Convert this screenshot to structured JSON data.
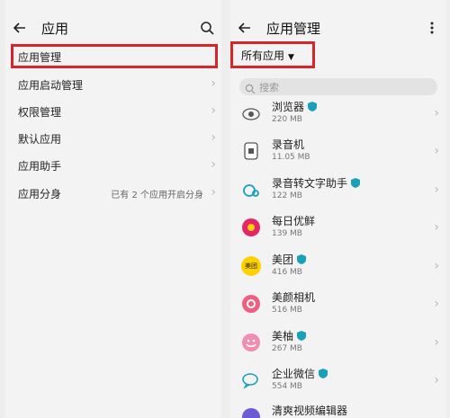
{
  "left": {
    "title": "应用",
    "items": [
      {
        "label": "应用管理"
      },
      {
        "label": "应用启动管理"
      },
      {
        "label": "权限管理"
      },
      {
        "label": "默认应用"
      },
      {
        "label": "应用助手"
      },
      {
        "label": "应用分身",
        "extra": "已有 2 个应用开启分身"
      }
    ]
  },
  "right": {
    "title": "应用管理",
    "filter_label": "所有应用",
    "search_placeholder": "搜索",
    "apps": [
      {
        "name": "浏览器",
        "size": "220 MB",
        "verified": true,
        "icon": "browser-icon"
      },
      {
        "name": "录音机",
        "size": "11.05 MB",
        "verified": false,
        "icon": "recorder-icon"
      },
      {
        "name": "录音转文字助手",
        "size": "122 MB",
        "verified": true,
        "icon": "transcribe-icon"
      },
      {
        "name": "每日优鲜",
        "size": "139 MB",
        "verified": false,
        "icon": "missfresh-icon"
      },
      {
        "name": "美团",
        "size": "416 MB",
        "verified": true,
        "icon": "meituan-icon",
        "icon_text": "美团"
      },
      {
        "name": "美颜相机",
        "size": "516 MB",
        "verified": false,
        "icon": "beauty-camera-icon"
      },
      {
        "name": "美柚",
        "size": "267 MB",
        "verified": true,
        "icon": "meiyou-icon"
      },
      {
        "name": "企业微信",
        "size": "554 MB",
        "verified": true,
        "icon": "wecom-icon"
      },
      {
        "name": "清爽视频编辑器",
        "size": "",
        "verified": false,
        "icon": "video-editor-icon"
      }
    ]
  },
  "colors": {
    "highlight": "#d4262b",
    "verified_badge": "#1aa0b8",
    "meituan": "#ffd100",
    "missfresh": "#e6246a",
    "beauty_camera": "#ef5f7f",
    "meiyou": "#f08db0"
  }
}
